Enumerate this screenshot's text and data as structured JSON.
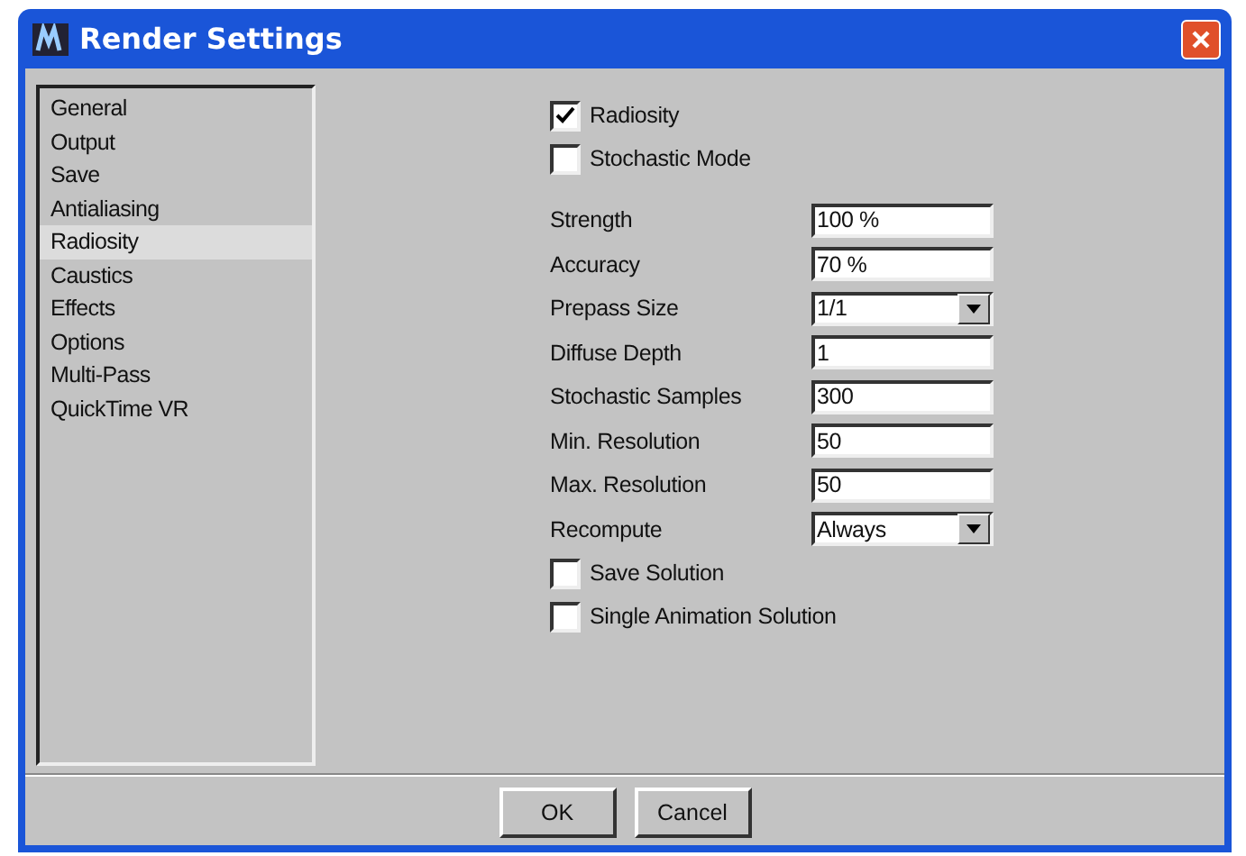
{
  "window": {
    "title": "Render Settings"
  },
  "sidebar": {
    "items": [
      {
        "label": "General",
        "selected": false
      },
      {
        "label": "Output",
        "selected": false
      },
      {
        "label": "Save",
        "selected": false
      },
      {
        "label": "Antialiasing",
        "selected": false
      },
      {
        "label": "Radiosity",
        "selected": true
      },
      {
        "label": "Caustics",
        "selected": false
      },
      {
        "label": "Effects",
        "selected": false
      },
      {
        "label": "Options",
        "selected": false
      },
      {
        "label": "Multi-Pass",
        "selected": false
      },
      {
        "label": "QuickTime VR",
        "selected": false
      }
    ]
  },
  "settings": [
    {
      "kind": "checkbox",
      "label": "Radiosity",
      "checked": true
    },
    {
      "kind": "checkbox",
      "label": "Stochastic Mode",
      "checked": false
    },
    {
      "kind": "text",
      "label": "Strength",
      "value": "100 %"
    },
    {
      "kind": "text",
      "label": "Accuracy",
      "value": "70 %"
    },
    {
      "kind": "select",
      "label": "Prepass Size",
      "value": "1/1"
    },
    {
      "kind": "text",
      "label": "Diffuse Depth",
      "value": "1"
    },
    {
      "kind": "text",
      "label": "Stochastic Samples",
      "value": "300"
    },
    {
      "kind": "text",
      "label": "Min. Resolution",
      "value": "50"
    },
    {
      "kind": "text",
      "label": "Max. Resolution",
      "value": "50"
    },
    {
      "kind": "select",
      "label": "Recompute",
      "value": "Always"
    },
    {
      "kind": "checkbox",
      "label": "Save Solution",
      "checked": false
    },
    {
      "kind": "checkbox",
      "label": "Single Animation Solution",
      "checked": false
    }
  ],
  "buttons": [
    "OK",
    "Cancel"
  ]
}
